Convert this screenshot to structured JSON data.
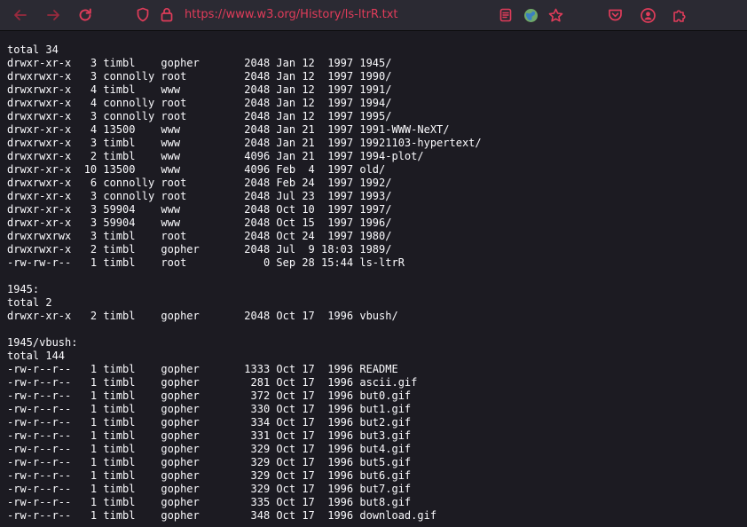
{
  "browser": {
    "url": "https://www.w3.org/History/ls-ltrR.txt",
    "icons": {
      "back": "arrow-left-icon",
      "forward": "arrow-right-icon",
      "reload": "reload-icon",
      "tracking": "shield-icon",
      "lock": "lock-icon",
      "reader": "reader-view-icon",
      "extension": "globe-extension-icon",
      "bookmark": "star-icon",
      "pocket": "pocket-icon",
      "account": "account-icon",
      "extensions": "puzzle-icon"
    },
    "colors": {
      "toolbar": "#2b2a33",
      "accent": "#e03c5a",
      "page_bg": "#1c1b22",
      "text": "#fbfbfe"
    }
  },
  "listing": {
    "lines": [
      "total 34",
      "drwxr-xr-x   3 timbl    gopher       2048 Jan 12  1997 1945/",
      "drwxrwxr-x   3 connolly root         2048 Jan 12  1997 1990/",
      "drwxrwxr-x   4 timbl    www          2048 Jan 12  1997 1991/",
      "drwxrwxr-x   4 connolly root         2048 Jan 12  1997 1994/",
      "drwxrwxr-x   3 connolly root         2048 Jan 12  1997 1995/",
      "drwxr-xr-x   4 13500    www          2048 Jan 21  1997 1991-WWW-NeXT/",
      "drwxrwxr-x   3 timbl    www          2048 Jan 21  1997 19921103-hypertext/",
      "drwxrwxr-x   2 timbl    www          4096 Jan 21  1997 1994-plot/",
      "drwxr-xr-x  10 13500    www          4096 Feb  4  1997 old/",
      "drwxrwxr-x   6 connolly root         2048 Feb 24  1997 1992/",
      "drwxr-xr-x   3 connolly root         2048 Jul 23  1997 1993/",
      "drwxr-xr-x   3 59904    www          2048 Oct 10  1997 1997/",
      "drwxr-xr-x   3 59904    www          2048 Oct 15  1997 1996/",
      "drwxrwxrwx   3 timbl    root         2048 Oct 24  1997 1980/",
      "drwxrwxr-x   2 timbl    gopher       2048 Jul  9 18:03 1989/",
      "-rw-rw-r--   1 timbl    root            0 Sep 28 15:44 ls-ltrR",
      "",
      "1945:",
      "total 2",
      "drwxr-xr-x   2 timbl    gopher       2048 Oct 17  1996 vbush/",
      "",
      "1945/vbush:",
      "total 144",
      "-rw-r--r--   1 timbl    gopher       1333 Oct 17  1996 README",
      "-rw-r--r--   1 timbl    gopher        281 Oct 17  1996 ascii.gif",
      "-rw-r--r--   1 timbl    gopher        372 Oct 17  1996 but0.gif",
      "-rw-r--r--   1 timbl    gopher        330 Oct 17  1996 but1.gif",
      "-rw-r--r--   1 timbl    gopher        334 Oct 17  1996 but2.gif",
      "-rw-r--r--   1 timbl    gopher        331 Oct 17  1996 but3.gif",
      "-rw-r--r--   1 timbl    gopher        329 Oct 17  1996 but4.gif",
      "-rw-r--r--   1 timbl    gopher        329 Oct 17  1996 but5.gif",
      "-rw-r--r--   1 timbl    gopher        329 Oct 17  1996 but6.gif",
      "-rw-r--r--   1 timbl    gopher        329 Oct 17  1996 but7.gif",
      "-rw-r--r--   1 timbl    gopher        335 Oct 17  1996 but8.gif",
      "-rw-r--r--   1 timbl    gopher        348 Oct 17  1996 download.gif"
    ]
  }
}
